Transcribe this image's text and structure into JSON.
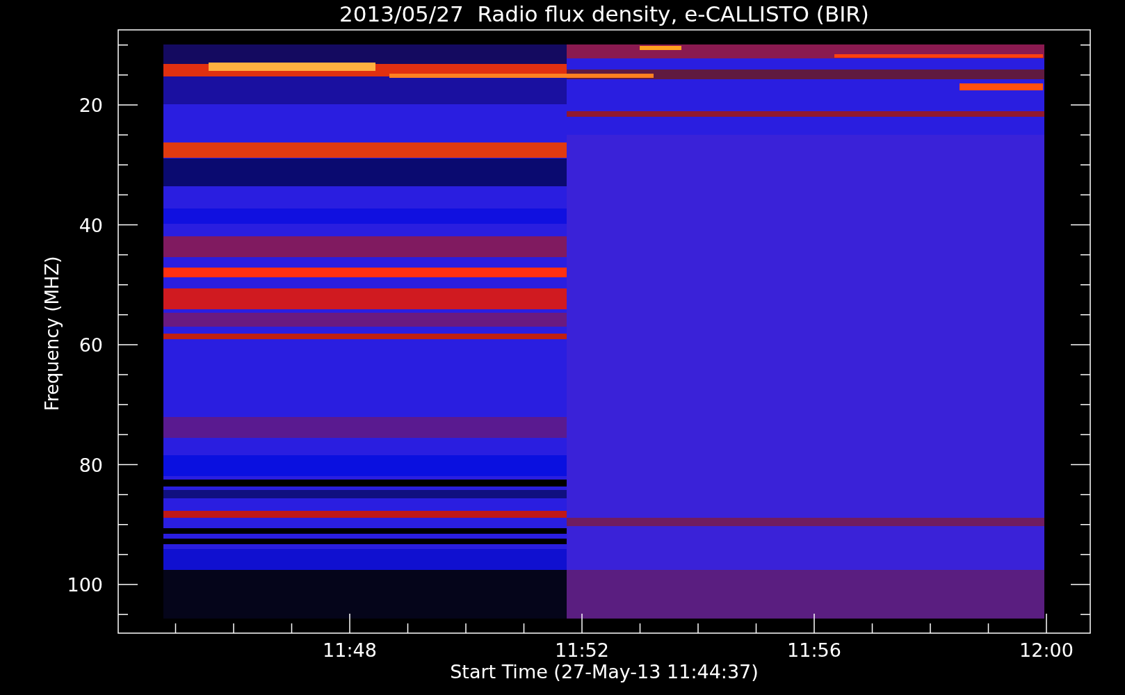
{
  "title": "2013/05/27  Radio flux density, e-CALLISTO (BIR)",
  "y_axis": {
    "label": "Frequency (MHZ)",
    "ticks": [
      "20",
      "40",
      "60",
      "80",
      "100"
    ]
  },
  "x_axis": {
    "label": "Start Time (27-May-13 11:44:37)",
    "ticks": [
      "11:48",
      "11:52",
      "11:56",
      "12:00"
    ]
  }
}
